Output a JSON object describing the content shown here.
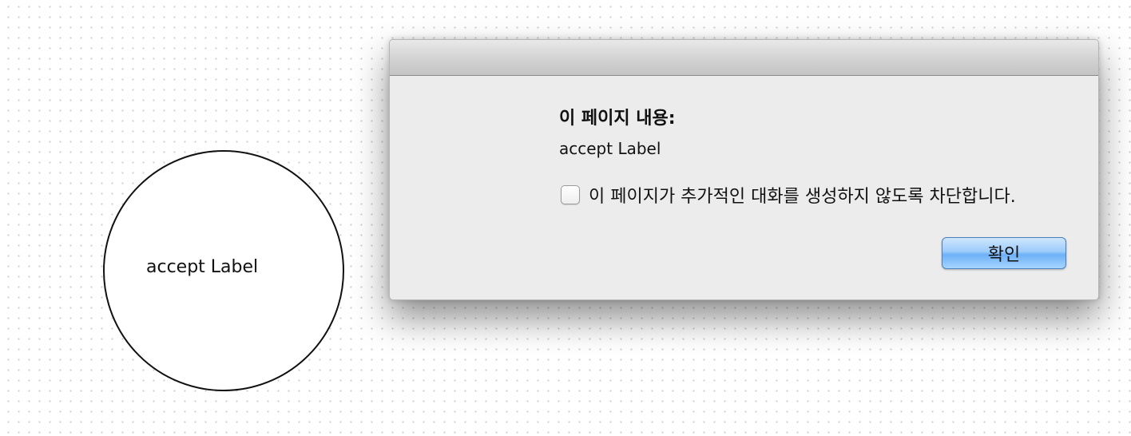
{
  "canvas": {
    "circle_label": "accept Label"
  },
  "dialog": {
    "heading": "이 페이지 내용:",
    "message": "accept Label",
    "block_checkbox": {
      "checked": false,
      "label": "이 페이지가 추가적인 대화를 생성하지 않도록 차단합니다."
    },
    "confirm_label": "확인"
  }
}
